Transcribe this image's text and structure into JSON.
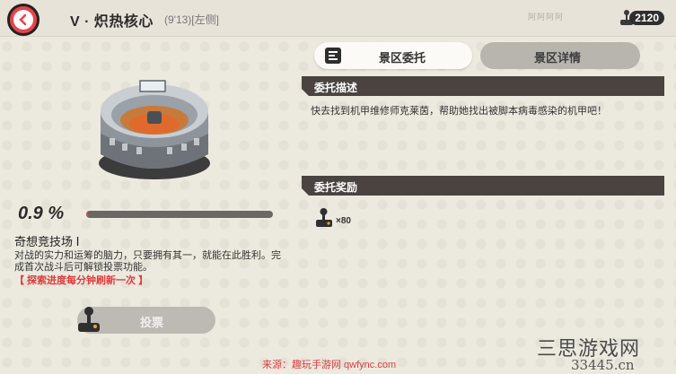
{
  "header": {
    "title": "V · 炽热核心",
    "subtitle": "(9'13)[左侧]",
    "coins": "2120",
    "back_icon": "back-arrow-icon",
    "coin_icon": "joystick-icon"
  },
  "watermark_top": "阿阿阿阿",
  "location": {
    "progress_text": "0.9 %",
    "progress_value": 0.009,
    "name": "奇想竞技场 Ⅰ",
    "description": "对战的实力和运筹的脑力，只要拥有其一，就能在此胜利。完成首次战斗后可解锁投票功能。",
    "note": "【 探索进度每分钟刷新一次 】",
    "vote_button": "投票",
    "vote_icon": "joystick-icon"
  },
  "tabs": [
    {
      "label": "景区委托",
      "active": true,
      "icon": "list-icon"
    },
    {
      "label": "景区详情",
      "active": false
    }
  ],
  "commission": {
    "desc_title": "委托描述",
    "desc_text": "快去找到机甲维修师克莱茵，帮助她找出被脚本病毒感染的机甲吧！",
    "reward_title": "委托奖励",
    "rewards": [
      {
        "icon": "joystick-icon",
        "qty": "×80"
      }
    ]
  },
  "watermarks": {
    "source": "来源：趣玩手游网 qwfync.com",
    "site": "三思游戏网",
    "url": "33445.cn"
  },
  "colors": {
    "accent_red": "#e9424a",
    "dark_bar": "#4a4340",
    "background": "#ece9df"
  }
}
